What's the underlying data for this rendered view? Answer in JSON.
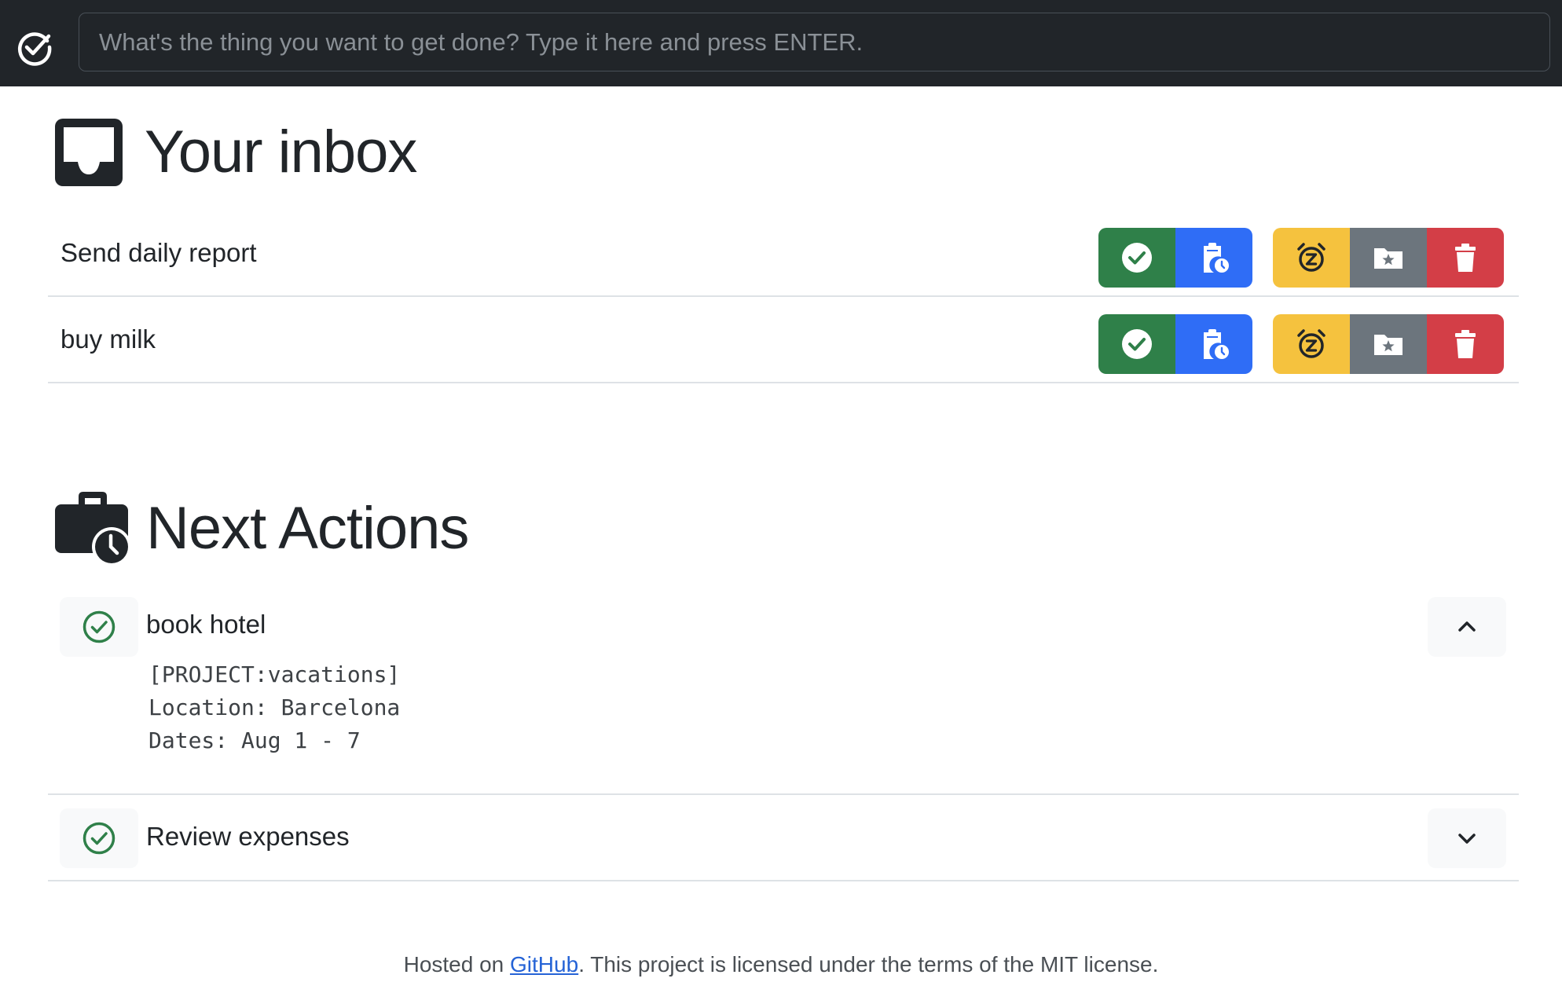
{
  "topbar": {
    "app_icon": "check-circle-icon",
    "input_placeholder": "What's the thing you want to get done? Type it here and press ENTER.",
    "input_value": ""
  },
  "inbox": {
    "icon": "inbox-tray-icon",
    "title": "Your inbox",
    "items": [
      {
        "label": "Send daily report"
      },
      {
        "label": "buy milk"
      }
    ],
    "actions": [
      {
        "name": "done",
        "icon": "check-circle-icon",
        "color": "#2f8049"
      },
      {
        "name": "next-action",
        "icon": "clipboard-clock-icon",
        "color": "#2f6df6"
      },
      {
        "name": "snooze",
        "icon": "alarm-snooze-icon",
        "color": "#f5c23e"
      },
      {
        "name": "project",
        "icon": "folder-star-icon",
        "color": "#6c757d"
      },
      {
        "name": "delete",
        "icon": "trash-icon",
        "color": "#d33e47"
      }
    ]
  },
  "next_actions": {
    "icon": "briefcase-clock-icon",
    "title": "Next Actions",
    "items": [
      {
        "label": "book hotel",
        "expanded": true,
        "toggle_icon": "chevron-up-icon",
        "notes": "[PROJECT:vacations]\nLocation: Barcelona\nDates: Aug 1 - 7"
      },
      {
        "label": "Review expenses",
        "expanded": false,
        "toggle_icon": "chevron-down-icon",
        "notes": ""
      }
    ]
  },
  "footer": {
    "prefix": "Hosted on ",
    "link_text": "GitHub",
    "suffix": ". This project is licensed under the terms of the MIT license."
  }
}
